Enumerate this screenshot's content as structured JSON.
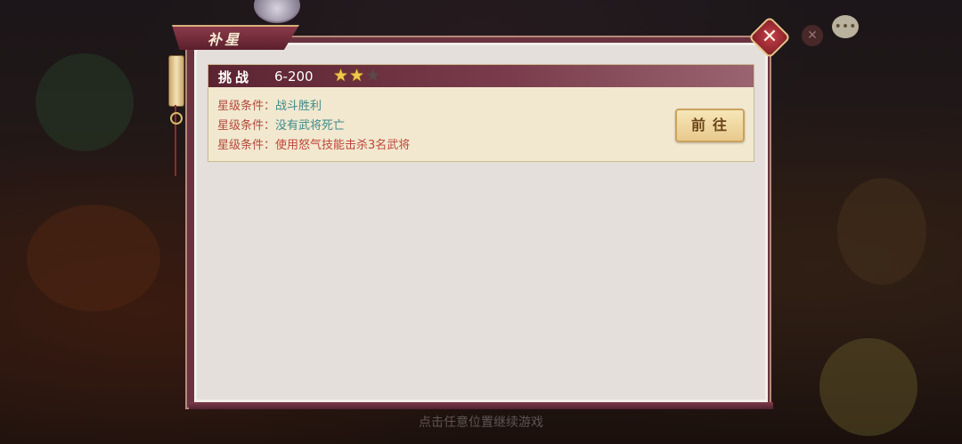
{
  "dialog": {
    "title": "补星",
    "close_icon": "close-icon"
  },
  "challenge": {
    "header_label": "挑战",
    "stage": "6-200",
    "stars_earned": 2,
    "stars_total": 3,
    "conditions": [
      {
        "label": "星级条件：",
        "value": "战斗胜利",
        "met": true
      },
      {
        "label": "星级条件：",
        "value": "没有武将死亡",
        "met": true
      },
      {
        "label": "星级条件：",
        "value": "使用怒气技能击杀3名武将",
        "met": false
      }
    ],
    "go_label": "前往"
  },
  "background": {
    "hint": "点击任意位置继续游戏",
    "chat_icon": "chat-bubble-icon"
  },
  "colors": {
    "accent": "#6b3340",
    "star_on": "#f3c84a",
    "condition_met": "#3f8a8a",
    "condition_unmet": "#c0463a"
  }
}
